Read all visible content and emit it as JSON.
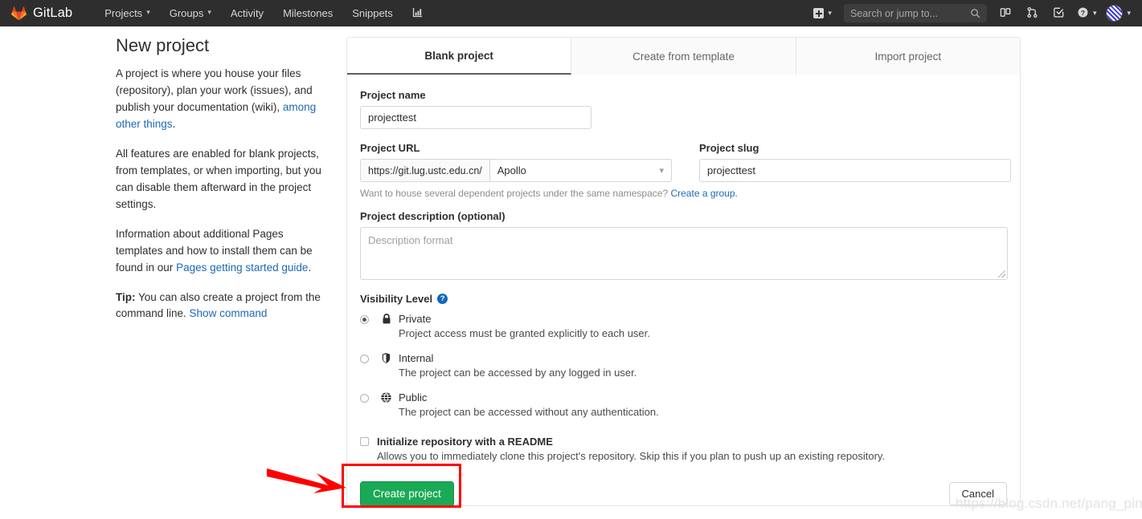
{
  "navbar": {
    "brand": "GitLab",
    "brand_icon": "gitlab-tanuki-logo",
    "items": [
      {
        "label": "Projects",
        "has_chevron": true
      },
      {
        "label": "Groups",
        "has_chevron": true
      },
      {
        "label": "Activity",
        "has_chevron": false
      },
      {
        "label": "Milestones",
        "has_chevron": false
      },
      {
        "label": "Snippets",
        "has_chevron": false
      }
    ],
    "analytics_icon": "chart-analytics-icon",
    "create_new_icon": "plus-square-icon",
    "search": {
      "placeholder": "Search or jump to...",
      "value": "",
      "icon": "search-icon"
    },
    "right_icons": [
      {
        "name": "issues-board-icon"
      },
      {
        "name": "merge-request-icon"
      },
      {
        "name": "todos-checkmark-icon"
      }
    ],
    "help_icon": "question-circle-icon",
    "avatar_icon": "user-avatar",
    "chevron_glyph": "⌄"
  },
  "sidebar": {
    "title": "New project",
    "para1_a": "A project is where you house your files (repository), plan your work (issues), and publish your documentation (wiki), ",
    "para1_link": "among other things",
    "para1_b": ".",
    "para2": "All features are enabled for blank projects, from templates, or when importing, but you can disable them afterward in the project settings.",
    "para3_a": "Information about additional Pages templates and how to install them can be found in our ",
    "para3_link": "Pages getting started guide",
    "para3_b": ".",
    "tip_label": "Tip:",
    "tip_text": " You can also create a project from the command line. ",
    "tip_link": "Show command"
  },
  "tabs": [
    {
      "label": "Blank project",
      "active": true
    },
    {
      "label": "Create from template",
      "active": false
    },
    {
      "label": "Import project",
      "active": false
    }
  ],
  "form": {
    "project_name_label": "Project name",
    "project_name_value": "projecttest",
    "project_name_placeholder": "",
    "project_url_label": "Project URL",
    "project_url_prefix": "https://git.lug.ustc.edu.cn/",
    "project_url_namespace": "Apollo",
    "project_slug_label": "Project slug",
    "project_slug_value": "projecttest",
    "namespace_hint": "Want to house several dependent projects under the same namespace? ",
    "namespace_hint_link": "Create a group.",
    "description_label": "Project description (optional)",
    "description_placeholder": "Description format",
    "description_value": "",
    "visibility_label": "Visibility Level",
    "visibility_help_glyph": "?",
    "visibility_options": [
      {
        "title": "Private",
        "description": "Project access must be granted explicitly to each user.",
        "icon": "lock-icon",
        "selected": true
      },
      {
        "title": "Internal",
        "description": "The project can be accessed by any logged in user.",
        "icon": "shield-icon",
        "selected": false
      },
      {
        "title": "Public",
        "description": "The project can be accessed without any authentication.",
        "icon": "globe-icon",
        "selected": false
      }
    ],
    "readme_label": "Initialize repository with a README",
    "readme_description": "Allows you to immediately clone this project's repository. Skip this if you plan to push up an existing repository.",
    "readme_checked": false,
    "create_button": "Create project",
    "cancel_button": "Cancel"
  },
  "annotations": {
    "highlight_color": "#fe0000",
    "arrow_color": "#fe0000",
    "watermark": "https://blog.csdn.net/pang_ping"
  },
  "colors": {
    "navbar_bg": "#2e2e2e",
    "primary_green": "#1aaa55",
    "link_blue": "#1b69b6"
  }
}
